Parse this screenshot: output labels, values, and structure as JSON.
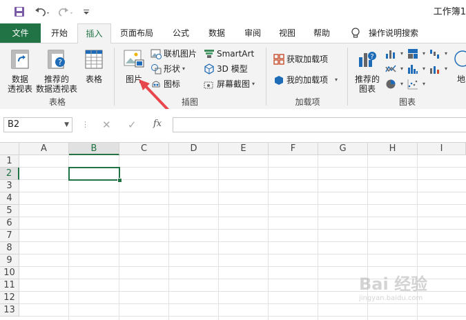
{
  "window": {
    "title": "工作簿1"
  },
  "tabs": [
    "文件",
    "开始",
    "插入",
    "页面布局",
    "公式",
    "数据",
    "审阅",
    "视图",
    "帮助",
    "操作说明搜索"
  ],
  "ribbon": {
    "groups": {
      "tables": {
        "label": "表格",
        "pivot": "数据\n透视表",
        "pivot_l1": "数据",
        "pivot_l2": "透视表",
        "rec_pivot_l1": "推荐的",
        "rec_pivot_l2": "数据透视表",
        "table": "表格"
      },
      "illustrations": {
        "label": "插图",
        "picture": "图片",
        "online_picture": "联机图片",
        "shapes": "形状",
        "icons": "图标",
        "smartart": "SmartArt",
        "model3d": "3D 模型",
        "screenshot": "屏幕截图"
      },
      "addins": {
        "label": "加载项",
        "get": "获取加载项",
        "mine": "我的加载项"
      },
      "charts": {
        "label": "图表",
        "rec_l1": "推荐的",
        "rec_l2": "图表",
        "maps": "地"
      }
    }
  },
  "formula_bar": {
    "name_box": "B2",
    "fx": "fx",
    "value": ""
  },
  "grid": {
    "columns": [
      "A",
      "B",
      "C",
      "D",
      "E",
      "F",
      "G",
      "H",
      "I"
    ],
    "rows": [
      "1",
      "2",
      "3",
      "4",
      "5",
      "6",
      "7",
      "8",
      "9",
      "10",
      "11",
      "12",
      "13"
    ],
    "selected_col": "B",
    "selected_row": "2"
  },
  "watermark": {
    "text": "Bai 经验",
    "sub": "jingyan.baidu.com"
  },
  "colors": {
    "excel_green": "#217346",
    "arrow_red": "#e8464d"
  }
}
